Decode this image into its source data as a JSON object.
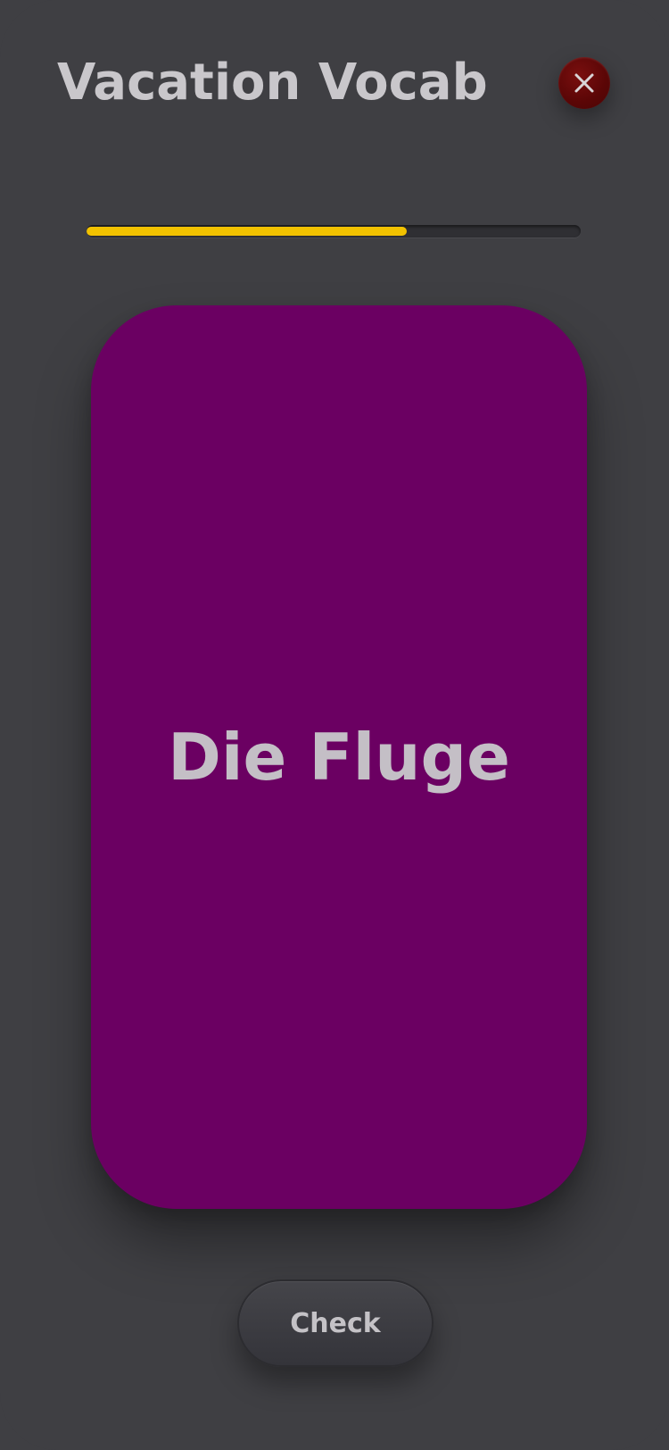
{
  "header": {
    "title": "Vacation Vocab",
    "close_icon": "close-icon"
  },
  "progress": {
    "fraction": 0.648,
    "color": "#f2c200"
  },
  "card": {
    "word": "Die Fluge",
    "color": "#6b0062"
  },
  "actions": {
    "check_label": "Check"
  }
}
